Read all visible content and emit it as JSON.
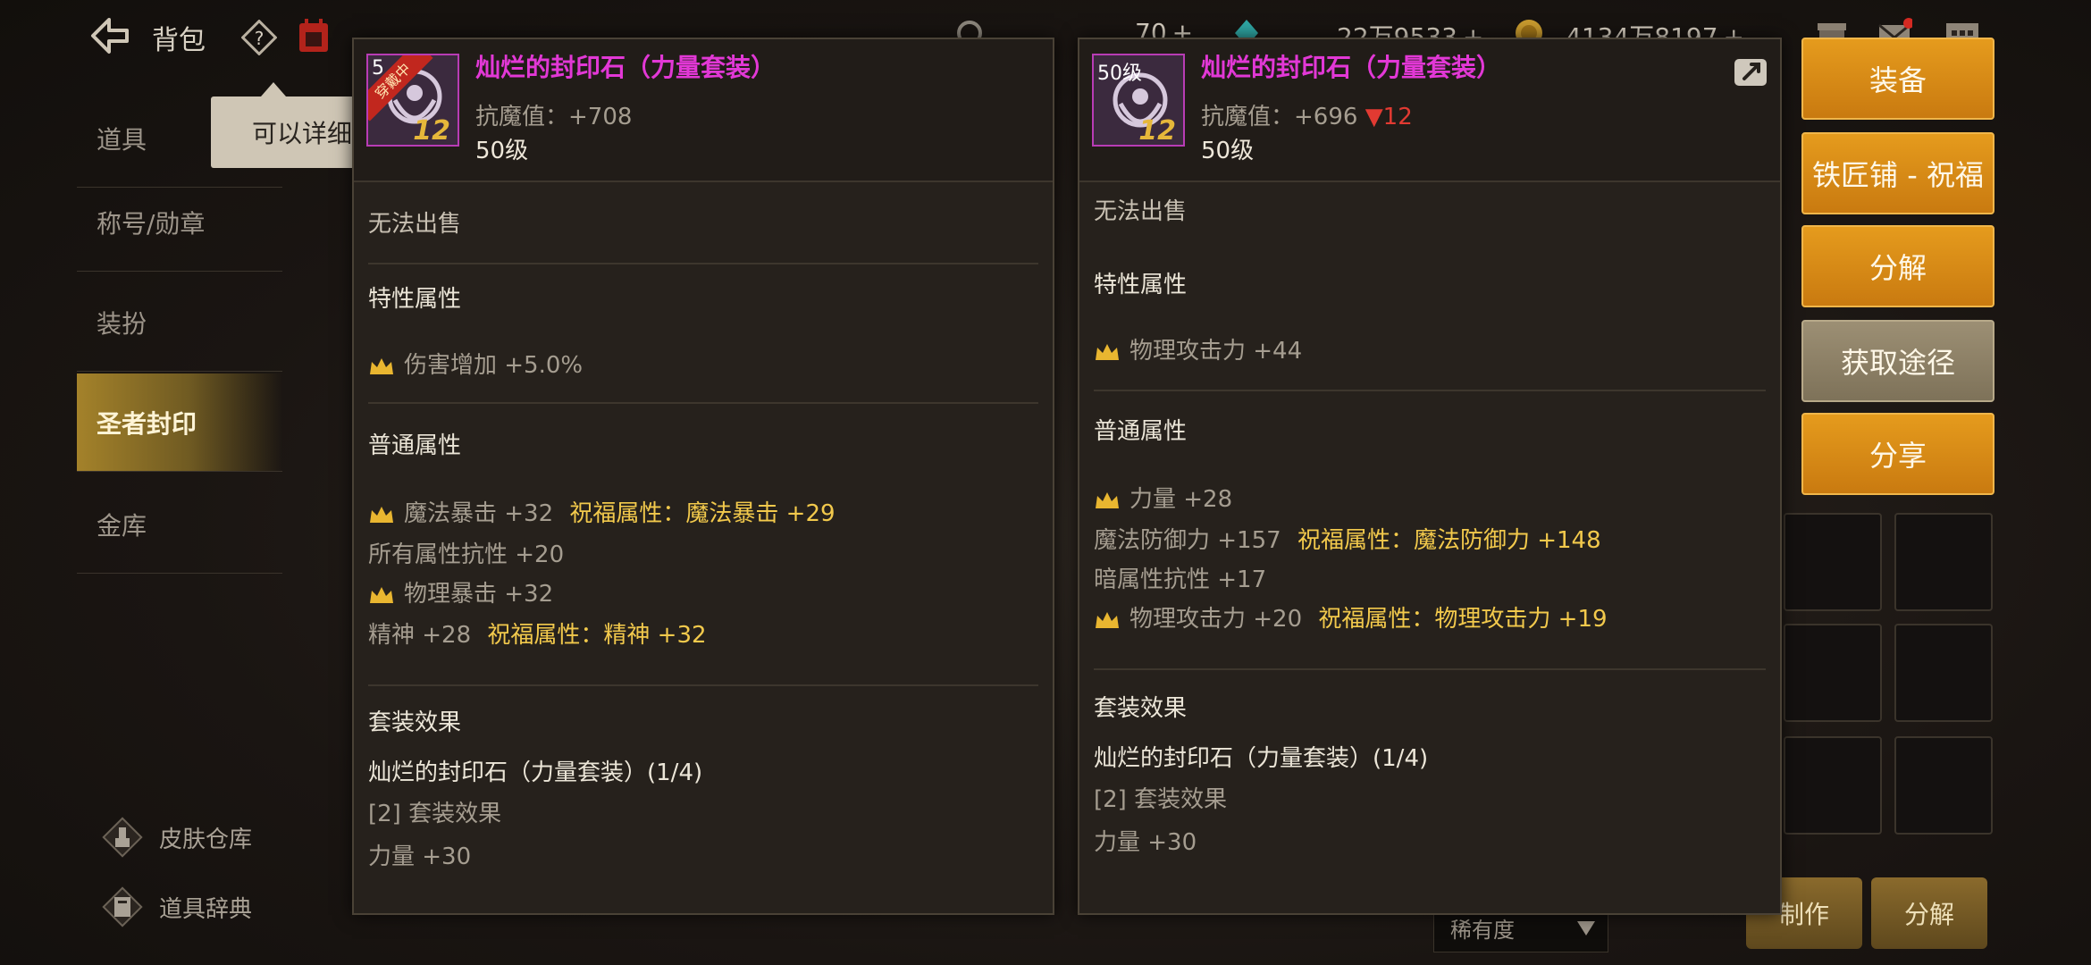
{
  "topbar": {
    "title": "背包",
    "currency1": "70",
    "currency2": "22万9533",
    "currency3": "4134万8197",
    "plus": "+"
  },
  "sidebar": {
    "items": [
      "道具",
      "称号/勋章",
      "装扮",
      "圣者封印",
      "金库"
    ],
    "tooltip": "可以详细",
    "bottom_links": [
      "皮肤仓库",
      "道具辞典"
    ]
  },
  "background": {
    "rarity_select": "稀有度",
    "craft_label": "制作",
    "decompose_label": "分解"
  },
  "left_panel": {
    "level_tag": "5",
    "equipped_tag": "穿戴中",
    "icon_badge": "12",
    "name": "灿烂的封印石（力量套装）",
    "resist": "抗魔值：+708",
    "level": "50级",
    "unsellable": "无法出售",
    "special_title": "特性属性",
    "special_attr": "伤害增加 +5.0%",
    "normal_title": "普通属性",
    "normal_attrs": [
      {
        "text": "魔法暴击 +32",
        "bless": "祝福属性：魔法暴击 +29"
      },
      {
        "text": "所有属性抗性 +20",
        "bless": ""
      },
      {
        "text": "物理暴击 +32",
        "bless": ""
      },
      {
        "text": "精神 +28",
        "bless": "祝福属性：精神 +32"
      }
    ],
    "set_title": "套装效果",
    "set_name": "灿烂的封印石（力量套装）(1/4)",
    "set_effect": "[2] 套装效果",
    "set_bonus": "力量 +30"
  },
  "right_panel": {
    "level_tag": "50级",
    "icon_badge": "12",
    "name": "灿烂的封印石（力量套装）",
    "resist": "抗魔值：+696",
    "resist_diff": "▼12",
    "level": "50级",
    "unsellable": "无法出售",
    "special_title": "特性属性",
    "special_attr": "物理攻击力 +44",
    "normal_title": "普通属性",
    "normal_attrs": [
      {
        "text": "力量 +28",
        "bless": ""
      },
      {
        "text": "魔法防御力 +157",
        "bless": "祝福属性：魔法防御力 +148"
      },
      {
        "text": "暗属性抗性 +17",
        "bless": ""
      },
      {
        "text": "物理攻击力 +20",
        "bless": "祝福属性：物理攻击力 +19"
      }
    ],
    "set_title": "套装效果",
    "set_name": "灿烂的封印石（力量套装）(1/4)",
    "set_effect": "[2] 套装效果",
    "set_bonus": "力量 +30"
  },
  "actions": [
    "装备",
    "铁匠铺 - 祝福",
    "分解",
    "获取途径",
    "分享"
  ],
  "colors": {
    "item_name": "#e238d6",
    "bless": "#f2c94c",
    "action": "#d98a14",
    "diff_down": "#e23a32"
  }
}
